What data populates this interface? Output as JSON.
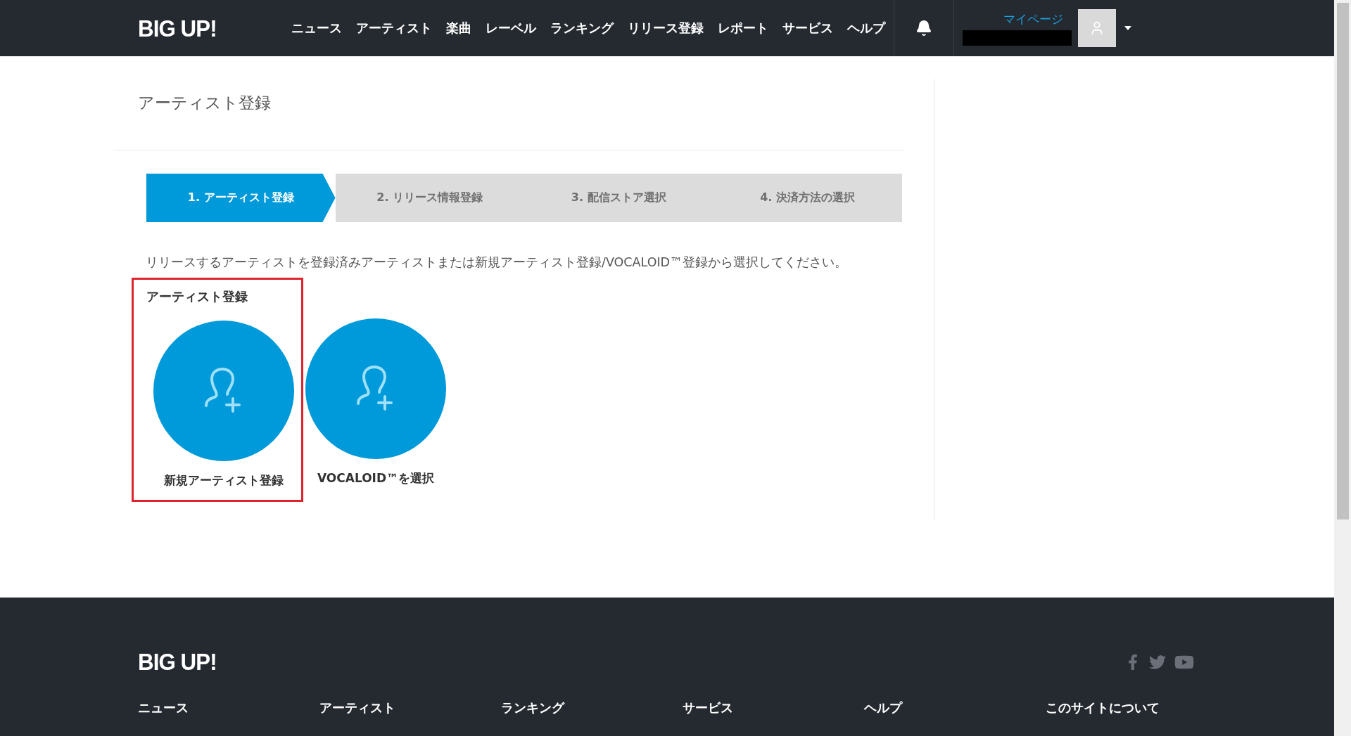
{
  "header": {
    "logo": "BIG UP!",
    "nav": [
      "ニュース",
      "アーティスト",
      "楽曲",
      "レーベル",
      "ランキング",
      "リリース登録",
      "レポート",
      "サービス",
      "ヘルプ"
    ],
    "mypage": "マイページ"
  },
  "page": {
    "title": "アーティスト登録",
    "steps": [
      {
        "label": "1. アーティスト登録",
        "selected": true
      },
      {
        "label": "2. リリース情報登録",
        "selected": false
      },
      {
        "label": "3. 配信ストア選択",
        "selected": false
      },
      {
        "label": "4. 決済方法の選択",
        "selected": false
      }
    ],
    "instruction": "リリースするアーティストを登録済みアーティストまたは新規アーティスト登録/VOCALOID™登録から選択してください。",
    "section_heading": "アーティスト登録",
    "options": [
      {
        "label": "新規アーティスト登録",
        "highlighted": true
      },
      {
        "label": "VOCALOID™を選択",
        "highlighted": false
      }
    ]
  },
  "footer": {
    "logo": "BIG UP!",
    "links": [
      "ニュース",
      "アーティスト",
      "ランキング",
      "サービス",
      "ヘルプ",
      "このサイトについて"
    ]
  }
}
